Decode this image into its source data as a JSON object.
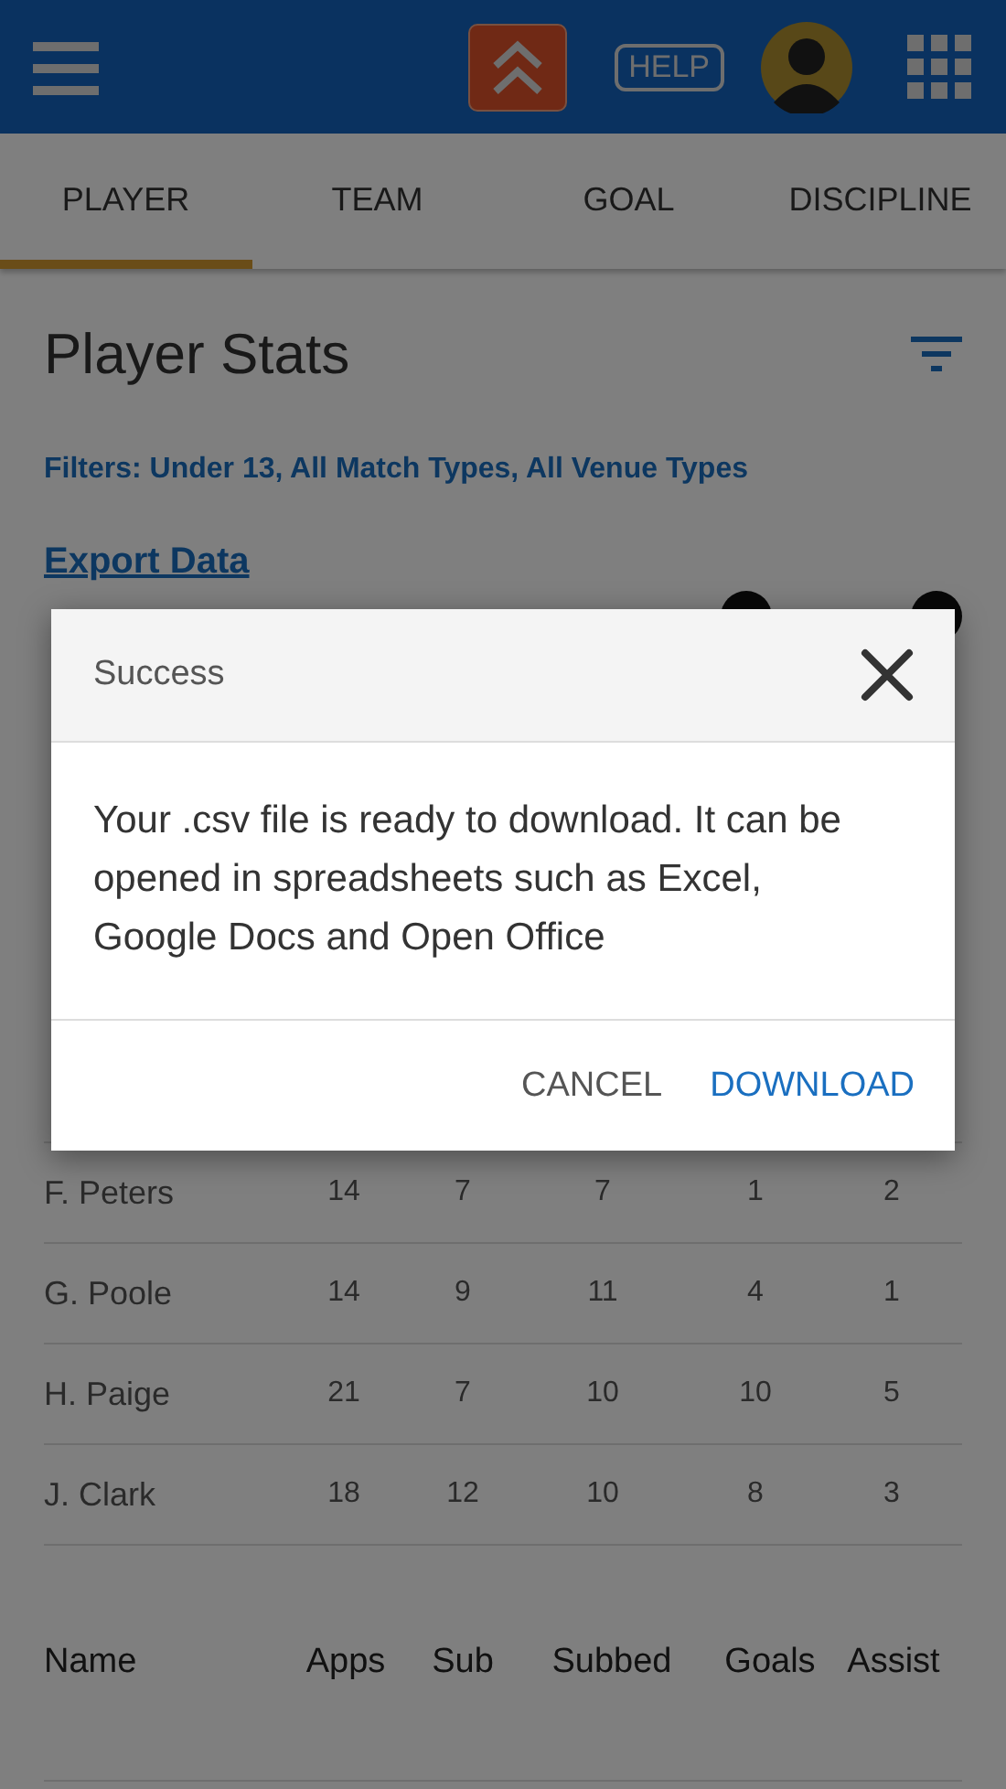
{
  "app_bar": {
    "help_label": "HELP"
  },
  "tabs": [
    {
      "label": "PLAYER",
      "selected": true
    },
    {
      "label": "TEAM",
      "selected": false
    },
    {
      "label": "GOAL",
      "selected": false
    },
    {
      "label": "DISCIPLINE",
      "selected": false
    }
  ],
  "page": {
    "title": "Player Stats",
    "filters": "Filters: Under 13, All Match Types, All Venue Types",
    "export_link": "Export Data"
  },
  "table": {
    "rows": [
      {
        "name": "F. Peters",
        "cells": [
          "14",
          "7",
          "7",
          "1",
          "2"
        ]
      },
      {
        "name": "G. Poole",
        "cells": [
          "14",
          "9",
          "11",
          "4",
          "1"
        ]
      },
      {
        "name": "H. Paige",
        "cells": [
          "21",
          "7",
          "10",
          "10",
          "5"
        ]
      },
      {
        "name": "J. Clark",
        "cells": [
          "18",
          "12",
          "10",
          "8",
          "3"
        ]
      }
    ],
    "footer_columns": [
      "Name",
      "Apps",
      "Sub",
      "Subbed",
      "Goals",
      "Assist"
    ]
  },
  "dialog": {
    "title": "Success",
    "message": "Your .csv file is ready to download. It can be opened in spreadsheets such as Excel, Google Docs and Open Office",
    "buttons": [
      {
        "label": "CANCEL",
        "kind": "secondary"
      },
      {
        "label": "DOWNLOAD",
        "kind": "primary"
      }
    ]
  }
}
